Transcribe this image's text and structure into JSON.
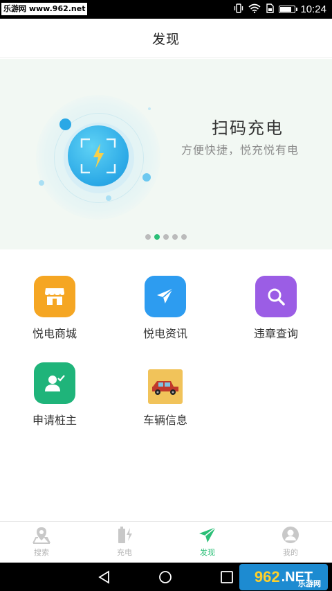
{
  "status_bar": {
    "watermark": "乐游网 www.962.net",
    "time": "10:24",
    "battery_level": 0.85,
    "icons": [
      "vibrate-icon",
      "wifi-icon",
      "sim-icon",
      "battery-icon"
    ]
  },
  "header": {
    "title": "发现"
  },
  "banner": {
    "title": "扫码充电",
    "subtitle": "方便快捷，悦充悦有电",
    "page_count": 5,
    "active_page": 2
  },
  "grid": [
    {
      "label": "悦电商城",
      "icon": "store-icon",
      "color": "#f5a623"
    },
    {
      "label": "悦电资讯",
      "icon": "paper-plane-icon",
      "color": "#2d9cf0"
    },
    {
      "label": "违章查询",
      "icon": "search-icon",
      "color": "#9b5de5"
    },
    {
      "label": "申请桩主",
      "icon": "user-check-icon",
      "color": "#1fb47a"
    },
    {
      "label": "车辆信息",
      "icon": "car-icon",
      "color": "#f1c35a"
    }
  ],
  "bottom_nav": [
    {
      "label": "搜索",
      "icon": "map-pin-icon",
      "active": false
    },
    {
      "label": "充电",
      "icon": "charging-icon",
      "active": false
    },
    {
      "label": "发现",
      "icon": "paper-plane-icon",
      "active": true
    },
    {
      "label": "我的",
      "icon": "user-circle-icon",
      "active": false
    }
  ],
  "watermark_br": {
    "num": "962",
    "net": ".NET",
    "text": "乐游网"
  },
  "colors": {
    "accent": "#2bbf77",
    "inactive": "#b5b5b5"
  }
}
